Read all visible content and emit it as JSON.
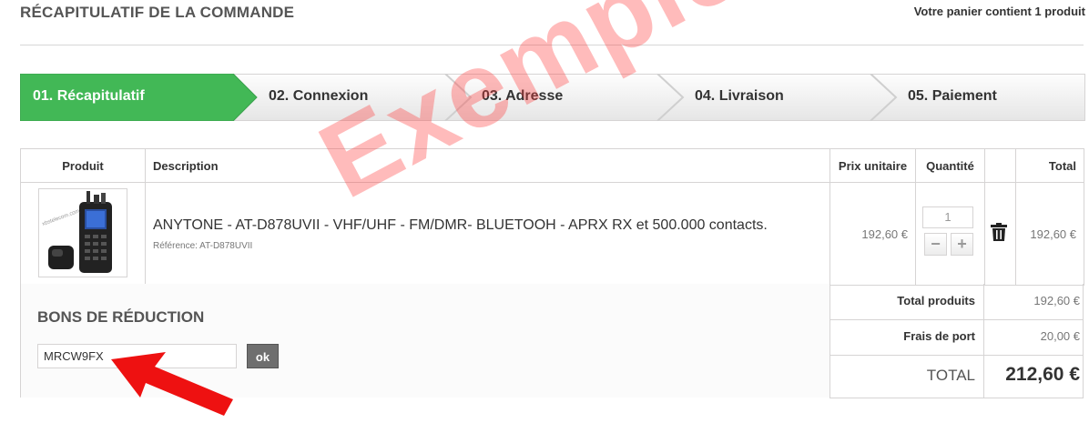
{
  "header": {
    "title": "RÉCAPITULATIF DE LA COMMANDE",
    "cart_summary": "Votre panier contient 1 produit"
  },
  "steps": [
    {
      "label": "01. Récapitulatif",
      "active": true
    },
    {
      "label": "02. Connexion",
      "active": false
    },
    {
      "label": "03. Adresse",
      "active": false
    },
    {
      "label": "04. Livraison",
      "active": false
    },
    {
      "label": "05. Paiement",
      "active": false
    }
  ],
  "table": {
    "headers": {
      "product": "Produit",
      "description": "Description",
      "unit_price": "Prix unitaire",
      "quantity": "Quantité",
      "total": "Total"
    },
    "item": {
      "title": "ANYTONE - AT-D878UVII - VHF/UHF - FM/DMR- BLUETOOH - APRX RX et 500.000 contacts.",
      "reference": "Référence: AT-D878UVII",
      "unit_price": "192,60 €",
      "quantity": "1",
      "total": "192,60 €",
      "image_watermark": "xbstelecom.com"
    }
  },
  "vouchers": {
    "title": "BONS DE RÉDUCTION",
    "code_value": "MRCW9FX",
    "submit_label": "ok"
  },
  "summary": {
    "total_products_label": "Total produits",
    "total_products_value": "192,60 €",
    "shipping_label": "Frais de port",
    "shipping_value": "20,00 €",
    "total_label": "TOTAL",
    "total_value": "212,60 €"
  },
  "overlay": {
    "watermark": "Exemple"
  },
  "icons": {
    "trash": "trash-icon",
    "minus": "minus-icon",
    "plus": "plus-icon",
    "arrow": "red-arrow-annotation"
  },
  "colors": {
    "active_step": "#42b856",
    "watermark": "#ff3c3c",
    "arrow": "#ee1111"
  }
}
